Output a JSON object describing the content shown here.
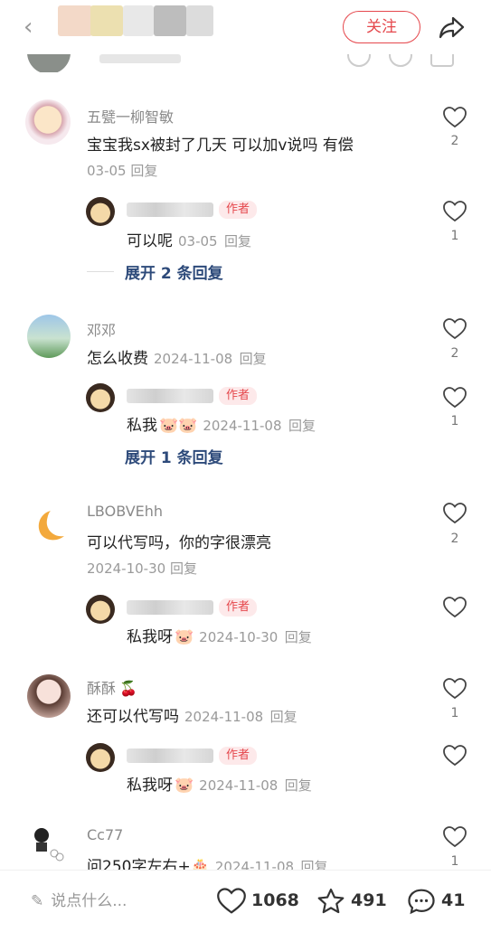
{
  "header": {
    "follow_label": "关注"
  },
  "comments": [
    {
      "name": "五甓一柳智敏",
      "text": "宝宝我sx被封了几天 可以加v说吗 有偿",
      "date": "03-05",
      "reply": "回复",
      "likes": "2",
      "author_reply": {
        "badge": "作者",
        "text": "可以呢",
        "date": "03-05",
        "reply": "回复",
        "likes": "1"
      },
      "expand": "展开 2 条回复"
    },
    {
      "name": "邓邓",
      "text": "怎么收费",
      "date": "2024-11-08",
      "reply": "回复",
      "likes": "2",
      "author_reply": {
        "badge": "作者",
        "text": "私我",
        "date": "2024-11-08",
        "reply": "回复",
        "likes": "1"
      },
      "expand": "展开 1 条回复"
    },
    {
      "name": "LBOBVEhh",
      "text": "可以代写吗，你的字很漂亮",
      "date": "2024-10-30",
      "reply": "回复",
      "likes": "2",
      "author_reply": {
        "badge": "作者",
        "text": "私我呀",
        "date": "2024-10-30",
        "reply": "回复",
        "likes": ""
      }
    },
    {
      "name": "酥酥",
      "text": "还可以代写吗",
      "date": "2024-11-08",
      "reply": "回复",
      "likes": "1",
      "author_reply": {
        "badge": "作者",
        "text": "私我呀",
        "date": "2024-11-08",
        "reply": "回复",
        "likes": ""
      }
    },
    {
      "name": "Cc77",
      "text": "问250字左右+",
      "date": "2024-11-08",
      "reply": "回复",
      "likes": "1"
    }
  ],
  "bottom": {
    "input_placeholder": "说点什么...",
    "likes": "1068",
    "stars": "491",
    "comments": "41"
  }
}
